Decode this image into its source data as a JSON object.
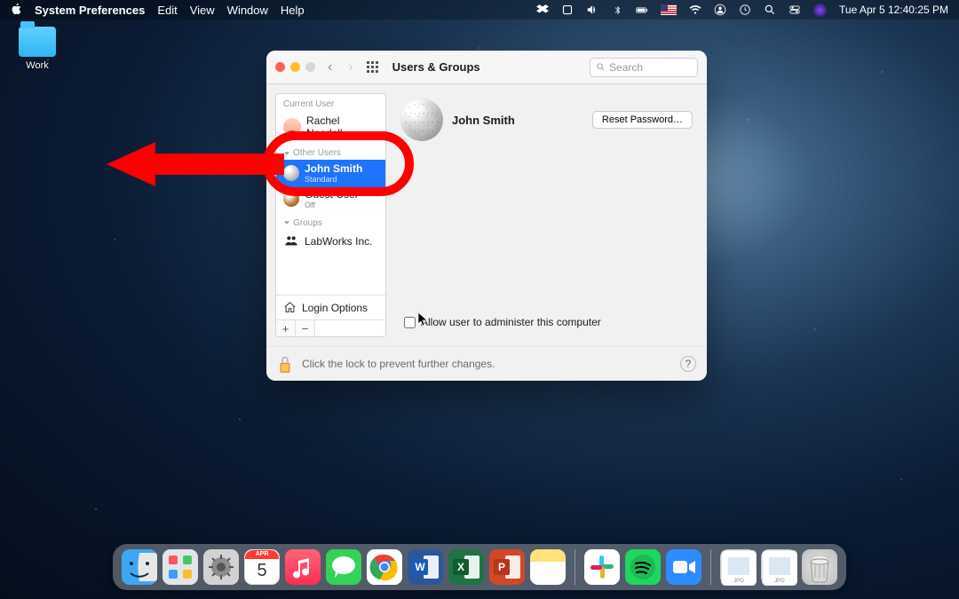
{
  "menubar": {
    "app": "System Preferences",
    "items": [
      "Edit",
      "View",
      "Window",
      "Help"
    ],
    "clock": "Tue Apr 5  12:40:25 PM"
  },
  "desktop": {
    "work_label": "Work"
  },
  "window": {
    "title": "Users & Groups",
    "search_placeholder": "Search"
  },
  "sidebar": {
    "current_user_header": "Current User",
    "current_user": "Rachel Needell",
    "other_users_header": "Other Users",
    "selected": {
      "name": "John Smith",
      "role": "Standard"
    },
    "guest": {
      "name": "Guest User",
      "role": "Off"
    },
    "groups_header": "Groups",
    "group": "LabWorks Inc.",
    "login_options": "Login Options"
  },
  "main": {
    "username": "John Smith",
    "reset_btn": "Reset Password…",
    "admin_label": "Allow user to administer this computer"
  },
  "footer": {
    "lock_text": "Click the lock to prevent further changes."
  },
  "calendar": {
    "month": "APR",
    "day": "5"
  }
}
